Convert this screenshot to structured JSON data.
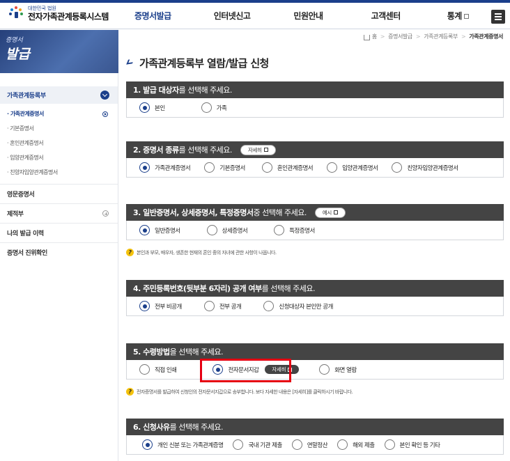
{
  "header": {
    "logo_sub": "대한민국 법원",
    "logo_main": "전자가족관계등록시스템",
    "nav": [
      {
        "label": "증명서발급",
        "active": true
      },
      {
        "label": "인터넷신고",
        "active": false
      },
      {
        "label": "민원안내",
        "active": false
      },
      {
        "label": "고객센터",
        "active": false
      },
      {
        "label": "통계",
        "active": false
      }
    ]
  },
  "sidebar": {
    "banner_small": "증명서",
    "banner_big": "발급",
    "active_group": "가족관계등록부",
    "sub_items": [
      {
        "label": "· 가족관계증명서",
        "active": true
      },
      {
        "label": "· 기본증명서",
        "active": false
      },
      {
        "label": "· 혼인관계증명서",
        "active": false
      },
      {
        "label": "· 입양관계증명서",
        "active": false
      },
      {
        "label": "· 친양자입양관계증명서",
        "active": false
      }
    ],
    "items": [
      {
        "label": "영문증명서",
        "expandable": false
      },
      {
        "label": "제적부",
        "expandable": true
      },
      {
        "label": "나의 발급 이력",
        "expandable": false
      },
      {
        "label": "증명서 진위확인",
        "expandable": false
      }
    ]
  },
  "breadcrumb": [
    "홈",
    "증명서발급",
    "가족관계등록부",
    "가족관계증명서"
  ],
  "page_title": "가족관계등록부 열람/발급 신청",
  "sections": [
    {
      "bold": "1. 발급 대상자",
      "rest": "를 선택해 주세요.",
      "pill": "",
      "options": [
        {
          "label": "본인",
          "checked": true
        },
        {
          "label": "가족",
          "checked": false
        }
      ]
    },
    {
      "bold": "2. 증명서 종류",
      "rest": "를 선택해 주세요.",
      "pill": "자세히",
      "options": [
        {
          "label": "가족관계증명서",
          "checked": true
        },
        {
          "label": "기본증명서",
          "checked": false
        },
        {
          "label": "혼인관계증명서",
          "checked": false
        },
        {
          "label": "입양관계증명서",
          "checked": false
        },
        {
          "label": "친양자입양관계증명서",
          "checked": false
        }
      ]
    },
    {
      "bold": "3. 일반증명서, 상세증명서, 특정증명서",
      "rest": " 중 선택해 주세요.",
      "pill": "예시",
      "options": [
        {
          "label": "일반증명서",
          "checked": true
        },
        {
          "label": "상세증명서",
          "checked": false
        },
        {
          "label": "특정증명서",
          "checked": false
        }
      ]
    },
    {
      "bold": "4. 주민등록번호(뒷부분 6자리) 공개 여부",
      "rest": "를 선택해 주세요.",
      "pill": "",
      "options": [
        {
          "label": "전부 비공개",
          "checked": true
        },
        {
          "label": "전부 공개",
          "checked": false
        },
        {
          "label": "신청대상자 본인만 공개",
          "checked": false
        }
      ]
    },
    {
      "bold": "5. 수령방법",
      "rest": "을 선택해 주세요.",
      "pill": "",
      "options": [
        {
          "label": "직접 인쇄",
          "checked": false
        },
        {
          "label": "전자문서지갑",
          "checked": true
        },
        {
          "label": "화면 열람",
          "checked": false
        }
      ],
      "option_pill": "자세히"
    },
    {
      "bold": "6. 신청사유",
      "rest": "를 선택해 주세요.",
      "pill": "",
      "options": [
        {
          "label": "개인 신분 또는 가족관계증명",
          "checked": true
        },
        {
          "label": "국내 기관 제출",
          "checked": false
        },
        {
          "label": "연말정산",
          "checked": false
        },
        {
          "label": "해외 제출",
          "checked": false
        },
        {
          "label": "본인 확인 등 기타",
          "checked": false
        }
      ]
    }
  ],
  "notes": {
    "section3": "본인과 부모, 배우자, 생존한 현재의 혼인 중의 자녀에 관한 사항이 나옵니다.",
    "section5": "전자증명서를 발급하여 신청인의 전자문서지갑으로 송부합니다. 보다 자세한 내용은 [자세히]를 클릭하시기 바랍니다."
  },
  "colors": {
    "brand": "#1b3f8b",
    "section_header": "#444444",
    "highlight": "#e60012",
    "note_icon": "#f4c20d"
  }
}
